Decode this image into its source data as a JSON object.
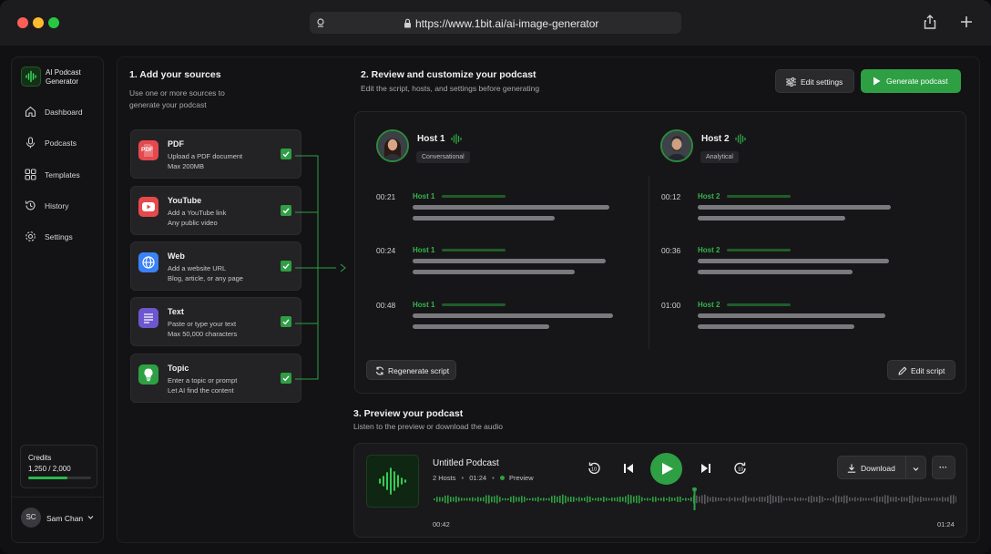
{
  "browser": {
    "url": "https://www.1bit.ai/ai-image-generator",
    "traffic_colors": [
      "#ff5f57",
      "#febc2e",
      "#28c840"
    ]
  },
  "app": {
    "name": "AI Podcast Generator",
    "name_line1": "AI Podcast",
    "name_line2": "Generator",
    "accent": "#2ea043"
  },
  "sidebar": {
    "items": [
      {
        "label": "Dashboard",
        "icon": "home-icon"
      },
      {
        "label": "Podcasts",
        "icon": "microphone-icon"
      },
      {
        "label": "Templates",
        "icon": "grid-icon"
      },
      {
        "label": "History",
        "icon": "history-icon"
      },
      {
        "label": "Settings",
        "icon": "gear-icon"
      }
    ],
    "credits": {
      "label": "Credits",
      "value": "1,250 / 2,000",
      "fraction": 0.625
    },
    "user": {
      "initials": "SC",
      "name": "Sam Chan"
    }
  },
  "sources": {
    "title": "1. Add your sources",
    "subtitle_line1": "Use one or more sources to",
    "subtitle_line2": "generate your podcast",
    "items": [
      {
        "title": "PDF",
        "line1": "Upload a PDF document",
        "line2": "Max 200MB",
        "color": "#e5484d",
        "icon": "pdf-icon",
        "badge": "PDF",
        "checked": true
      },
      {
        "title": "YouTube",
        "line1": "Add a YouTube link",
        "line2": "Any public video",
        "color": "#e5484d",
        "icon": "youtube-icon",
        "checked": true
      },
      {
        "title": "Web",
        "line1": "Add a website URL",
        "line2": "Blog, article, or any page",
        "color": "#3b82f6",
        "icon": "globe-icon",
        "checked": true
      },
      {
        "title": "Text",
        "line1": "Paste or type your text",
        "line2": "Max 50,000 characters",
        "color": "#6e56cf",
        "icon": "text-icon",
        "checked": true
      },
      {
        "title": "Topic",
        "line1": "Enter a topic or prompt",
        "line2": "Let AI find the content",
        "color": "#2ea043",
        "icon": "lightbulb-icon",
        "checked": true
      }
    ]
  },
  "review": {
    "title": "2. Review and customize your podcast",
    "subtitle": "Edit the script, hosts, and settings before generating",
    "edit_settings_label": "Edit settings",
    "generate_label": "Generate podcast",
    "hosts": [
      {
        "name": "Host 1",
        "tag": "Conversational",
        "segments": [
          {
            "time": "00:21",
            "speaker": "Host 1"
          },
          {
            "time": "00:24",
            "speaker": "Host 1"
          },
          {
            "time": "00:48",
            "speaker": "Host 1"
          }
        ]
      },
      {
        "name": "Host 2",
        "tag": "Analytical",
        "segments": [
          {
            "time": "00:12",
            "speaker": "Host 2"
          },
          {
            "time": "00:36",
            "speaker": "Host 2"
          },
          {
            "time": "01:00",
            "speaker": "Host 2"
          }
        ]
      }
    ],
    "regenerate_label": "Regenerate script",
    "edit_script_label": "Edit script"
  },
  "preview": {
    "title": "3. Preview your podcast",
    "subtitle": "Listen to the preview or download the audio",
    "podcast_title": "Untitled Podcast",
    "hosts_count": "2 Hosts",
    "duration": "01:24",
    "status": "Preview",
    "current_time": "00:42",
    "total_time": "01:24",
    "progress": 0.5,
    "download_label": "Download",
    "more_label": "···"
  }
}
